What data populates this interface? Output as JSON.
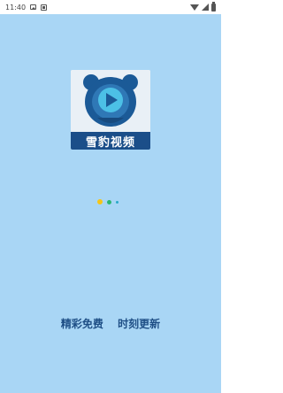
{
  "status_bar": {
    "time": "11:40",
    "icons": [
      "image-notification-icon",
      "box-notification-icon",
      "wifi-icon",
      "signal-icon",
      "battery-icon"
    ]
  },
  "splash": {
    "app_logo_text": "雪豹视频",
    "slogan_left": "精彩免费",
    "slogan_right": "时刻更新"
  },
  "loading_indicator": {
    "dot_colors": [
      "#f5c518",
      "#2bb673",
      "#2aa9c9"
    ]
  },
  "colors": {
    "background": "#a9d6f5",
    "logo_band": "#1b4e89",
    "slogan_text": "#1f4f86"
  }
}
